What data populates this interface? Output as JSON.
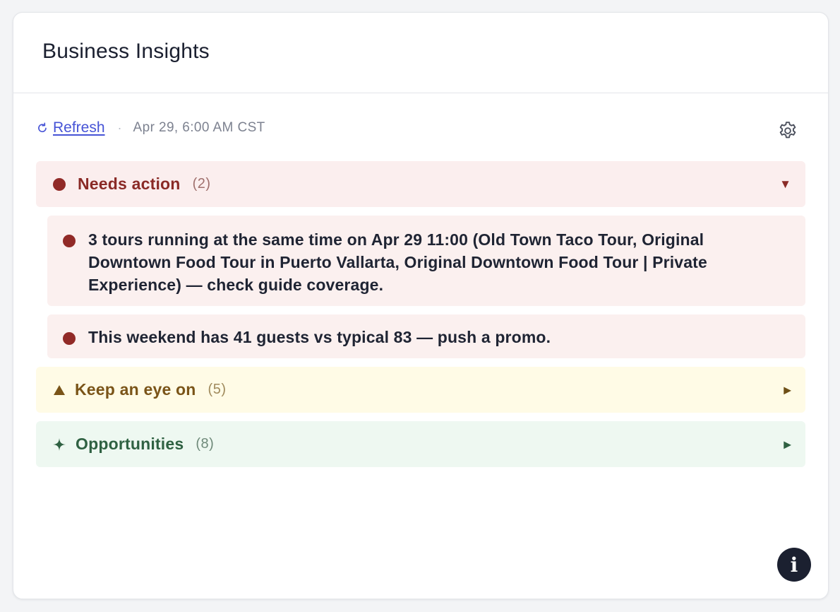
{
  "card": {
    "title": "Business Insights"
  },
  "toolbar": {
    "refresh_label": "Refresh",
    "separator": "·",
    "timestamp": "Apr 29, 6:00 AM CST",
    "settings_icon": "gear-icon"
  },
  "sections": {
    "needs_action": {
      "label": "Needs action",
      "count": "(2)",
      "expanded": true,
      "chevron": "▼",
      "color": "#8a2a26",
      "items": [
        {
          "text": "3 tours running at the same time on Apr 29 11:00 (Old Town Taco Tour, Original Downtown Food Tour in Puerto Vallarta, Original Downtown Food Tour | Private Experience) — check guide coverage."
        },
        {
          "text": "This weekend has 41 guests vs typical 83 — push a promo."
        }
      ]
    },
    "keep_an_eye_on": {
      "label": "Keep an eye on",
      "count": "(5)",
      "expanded": false,
      "icon": "▲",
      "chevron": "▶",
      "color": "#7a5418"
    },
    "opportunities": {
      "label": "Opportunities",
      "count": "(8)",
      "expanded": false,
      "icon": "✦",
      "chevron": "▶",
      "color": "#2f6142"
    }
  },
  "info_button": {
    "label": "i"
  }
}
